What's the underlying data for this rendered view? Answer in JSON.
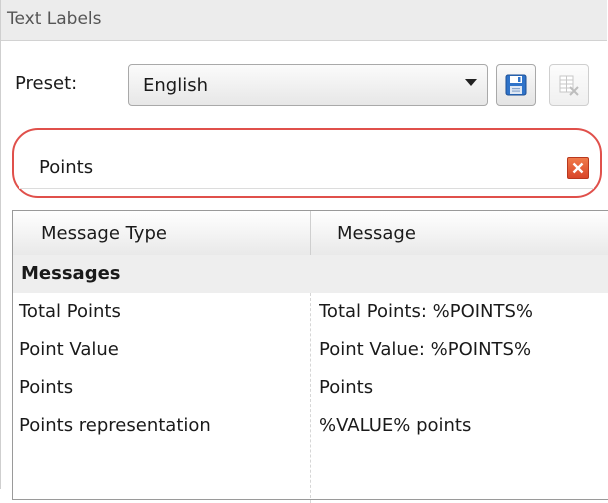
{
  "panel": {
    "title": "Text Labels"
  },
  "preset": {
    "label": "Preset:",
    "selected": "English",
    "save_icon": "floppy-disk-icon",
    "delete_icon": "delete-table-icon"
  },
  "search": {
    "value": "Points",
    "clear_icon": "close-icon",
    "highlight_color": "#e0504b"
  },
  "table": {
    "columns": [
      "Message Type",
      "Message"
    ],
    "group": "Messages",
    "rows": [
      {
        "type": "Total Points",
        "message": "Total Points: %POINTS%"
      },
      {
        "type": "Point Value",
        "message": "Point Value: %POINTS%"
      },
      {
        "type": "Points",
        "message": "Points"
      },
      {
        "type": "Points representation",
        "message": "%VALUE% points"
      }
    ]
  }
}
